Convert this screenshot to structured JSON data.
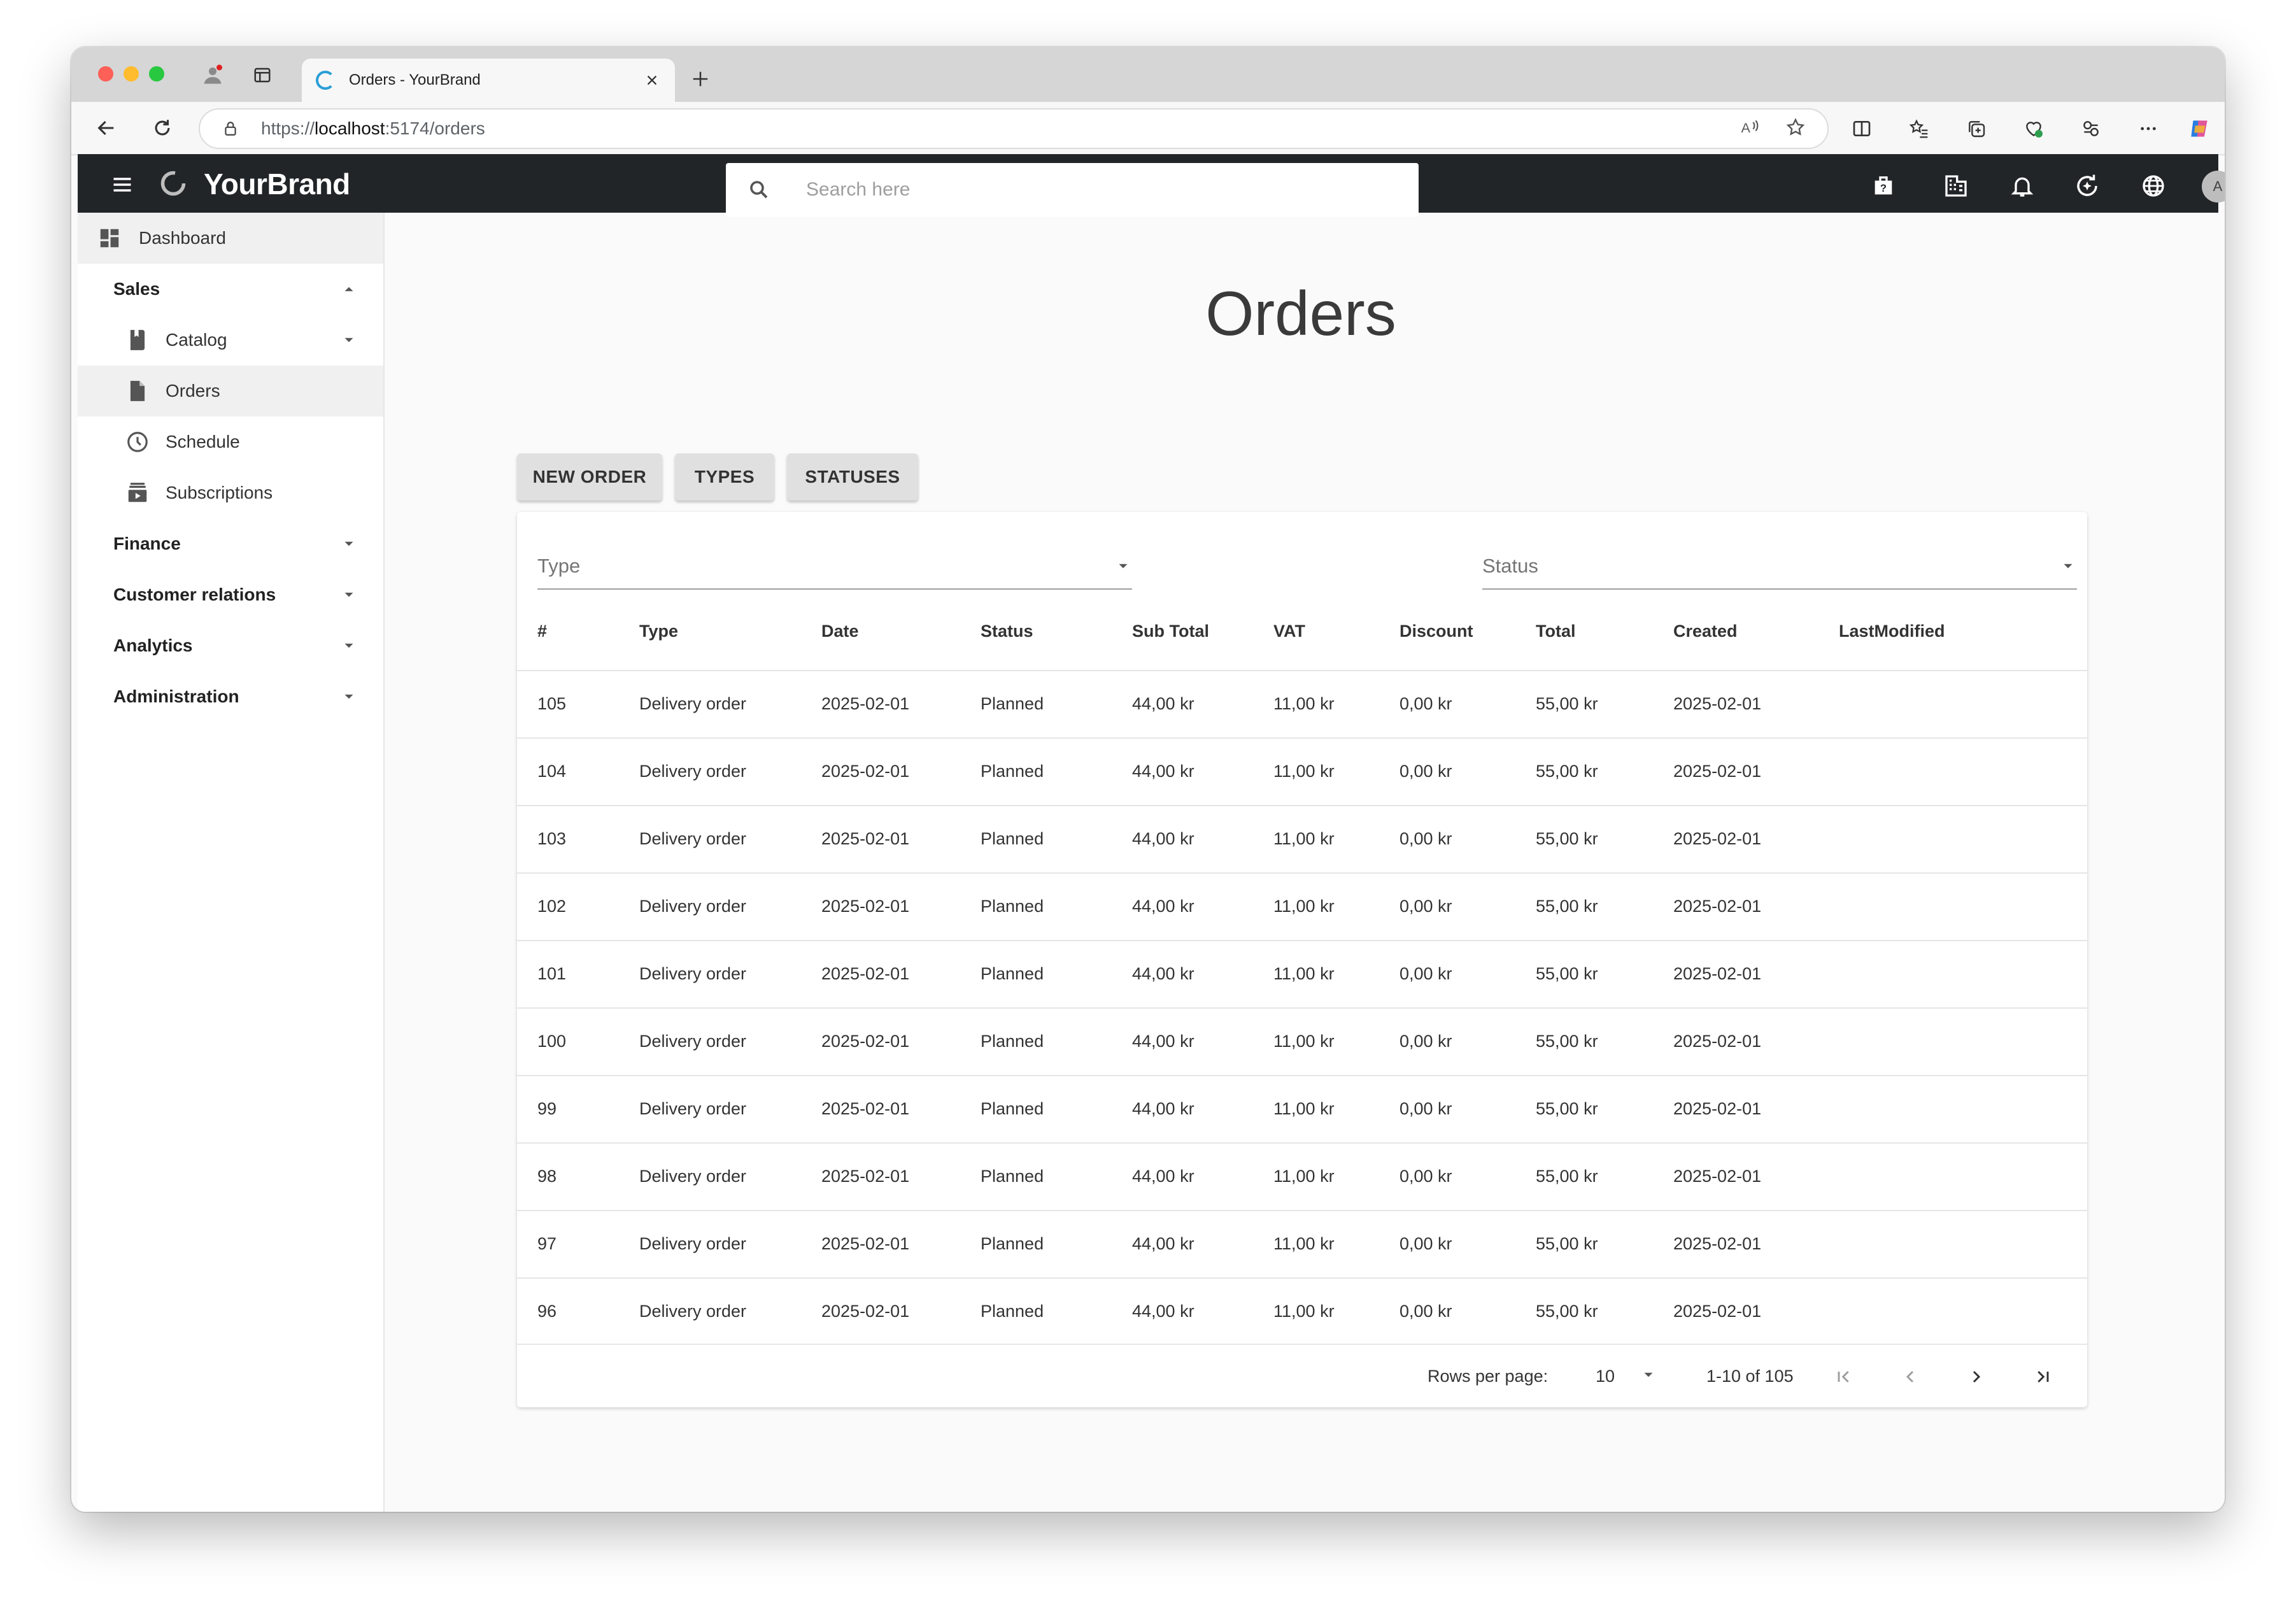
{
  "browser": {
    "tab_title": "Orders - YourBrand",
    "url_scheme_host_prefix": "https://",
    "url_host": "localhost",
    "url_rest": ":5174/orders"
  },
  "app": {
    "brand": "YourBrand",
    "search_placeholder": "Search here",
    "avatar_initial": "A"
  },
  "sidebar": {
    "dashboard": "Dashboard",
    "sales": "Sales",
    "catalog": "Catalog",
    "orders": "Orders",
    "schedule": "Schedule",
    "subscriptions": "Subscriptions",
    "finance": "Finance",
    "customer_relations": "Customer relations",
    "analytics": "Analytics",
    "administration": "Administration"
  },
  "page": {
    "title": "Orders",
    "buttons": {
      "new_order": "NEW ORDER",
      "types": "TYPES",
      "statuses": "STATUSES"
    },
    "filters": {
      "type": "Type",
      "status": "Status"
    }
  },
  "table": {
    "headers": {
      "num": "#",
      "type": "Type",
      "date": "Date",
      "status": "Status",
      "subtotal": "Sub Total",
      "vat": "VAT",
      "discount": "Discount",
      "total": "Total",
      "created": "Created",
      "modified": "LastModified"
    },
    "rows": [
      {
        "num": "105",
        "type": "Delivery order",
        "date": "2025-02-01",
        "status": "Planned",
        "subtotal": "44,00 kr",
        "vat": "11,00 kr",
        "discount": "0,00 kr",
        "total": "55,00 kr",
        "created": "2025-02-01",
        "modified": ""
      },
      {
        "num": "104",
        "type": "Delivery order",
        "date": "2025-02-01",
        "status": "Planned",
        "subtotal": "44,00 kr",
        "vat": "11,00 kr",
        "discount": "0,00 kr",
        "total": "55,00 kr",
        "created": "2025-02-01",
        "modified": ""
      },
      {
        "num": "103",
        "type": "Delivery order",
        "date": "2025-02-01",
        "status": "Planned",
        "subtotal": "44,00 kr",
        "vat": "11,00 kr",
        "discount": "0,00 kr",
        "total": "55,00 kr",
        "created": "2025-02-01",
        "modified": ""
      },
      {
        "num": "102",
        "type": "Delivery order",
        "date": "2025-02-01",
        "status": "Planned",
        "subtotal": "44,00 kr",
        "vat": "11,00 kr",
        "discount": "0,00 kr",
        "total": "55,00 kr",
        "created": "2025-02-01",
        "modified": ""
      },
      {
        "num": "101",
        "type": "Delivery order",
        "date": "2025-02-01",
        "status": "Planned",
        "subtotal": "44,00 kr",
        "vat": "11,00 kr",
        "discount": "0,00 kr",
        "total": "55,00 kr",
        "created": "2025-02-01",
        "modified": ""
      },
      {
        "num": "100",
        "type": "Delivery order",
        "date": "2025-02-01",
        "status": "Planned",
        "subtotal": "44,00 kr",
        "vat": "11,00 kr",
        "discount": "0,00 kr",
        "total": "55,00 kr",
        "created": "2025-02-01",
        "modified": ""
      },
      {
        "num": "99",
        "type": "Delivery order",
        "date": "2025-02-01",
        "status": "Planned",
        "subtotal": "44,00 kr",
        "vat": "11,00 kr",
        "discount": "0,00 kr",
        "total": "55,00 kr",
        "created": "2025-02-01",
        "modified": ""
      },
      {
        "num": "98",
        "type": "Delivery order",
        "date": "2025-02-01",
        "status": "Planned",
        "subtotal": "44,00 kr",
        "vat": "11,00 kr",
        "discount": "0,00 kr",
        "total": "55,00 kr",
        "created": "2025-02-01",
        "modified": ""
      },
      {
        "num": "97",
        "type": "Delivery order",
        "date": "2025-02-01",
        "status": "Planned",
        "subtotal": "44,00 kr",
        "vat": "11,00 kr",
        "discount": "0,00 kr",
        "total": "55,00 kr",
        "created": "2025-02-01",
        "modified": ""
      },
      {
        "num": "96",
        "type": "Delivery order",
        "date": "2025-02-01",
        "status": "Planned",
        "subtotal": "44,00 kr",
        "vat": "11,00 kr",
        "discount": "0,00 kr",
        "total": "55,00 kr",
        "created": "2025-02-01",
        "modified": ""
      }
    ]
  },
  "pagination": {
    "rows_per_page_label": "Rows per page:",
    "rows_per_page": "10",
    "range": "1-10 of 105"
  },
  "icons": {
    "menu": "hamburger-icon",
    "search": "search-icon",
    "help": "help-icon",
    "org": "organization-icon",
    "bell": "notifications-icon",
    "sync": "ai-sync-icon",
    "globe": "language-icon"
  },
  "colors": {
    "appbar": "#222528",
    "accent_tab": "#2a9fd6",
    "active_row": "#f0f0f0"
  }
}
